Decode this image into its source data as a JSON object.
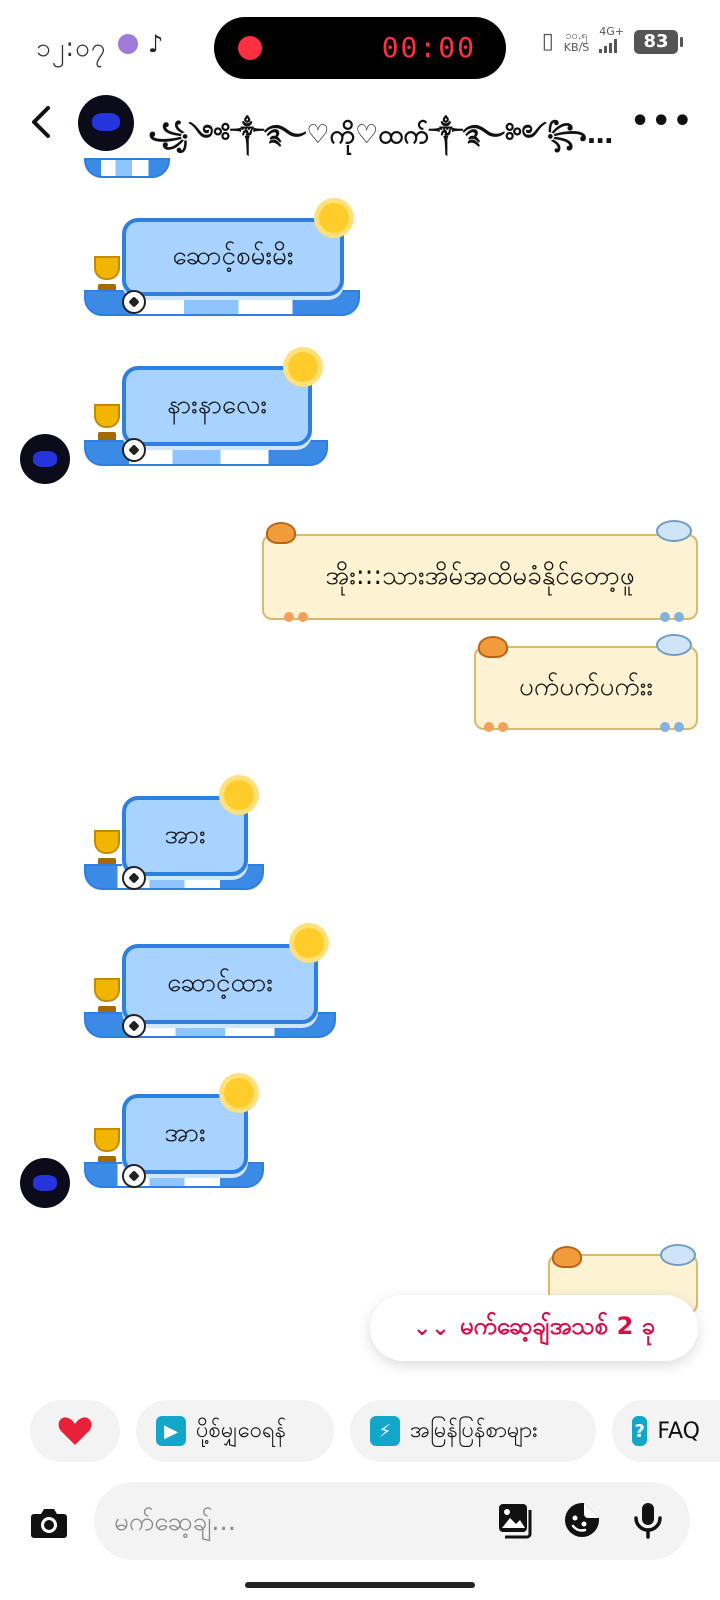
{
  "status_bar": {
    "time": "၁၂:၀၇",
    "recording_timer": "00:00",
    "net_speed_value": "၁၀.၅",
    "net_speed_unit": "KB/S",
    "network_type": "4G+",
    "battery": "83"
  },
  "header": {
    "title": "꧁༺༒࿐♡ကို♡ထက်༒࿐༻꧂♡Edit♡(..."
  },
  "messages": [
    {
      "side": "left",
      "style": "football",
      "text": "ဆောင့်စမ်းမိး"
    },
    {
      "side": "left",
      "style": "football",
      "text": "နားနာလေး"
    },
    {
      "side": "right",
      "style": "cat",
      "text": "အိုး:::သားအိမ်အထိမခံနိုင်တော့ဖူ"
    },
    {
      "side": "right",
      "style": "cat",
      "text": "ပက်ပက်ပက်းး"
    },
    {
      "side": "left",
      "style": "football",
      "text": "အား"
    },
    {
      "side": "left",
      "style": "football",
      "text": "ဆောင့်ထား"
    },
    {
      "side": "left",
      "style": "football",
      "text": "အား"
    }
  ],
  "new_messages_pill": "မက်ဆေ့ချ်အသစ် 2 ခု",
  "quick_actions": [
    {
      "label": "",
      "icon": "heart-icon"
    },
    {
      "label": "ပို့စ်မျှဝေရန်",
      "icon": "play-icon"
    },
    {
      "label": "အမြန်ပြန်စာများ",
      "icon": "lightning-icon"
    },
    {
      "label": "FAQ",
      "icon": "question-icon"
    }
  ],
  "input": {
    "placeholder": "မက်ဆေ့ချ်..."
  },
  "colors": {
    "accent_red": "#d4104a",
    "bubble_blue": "#a8d2ff",
    "bubble_cream": "#fdf3d2"
  }
}
